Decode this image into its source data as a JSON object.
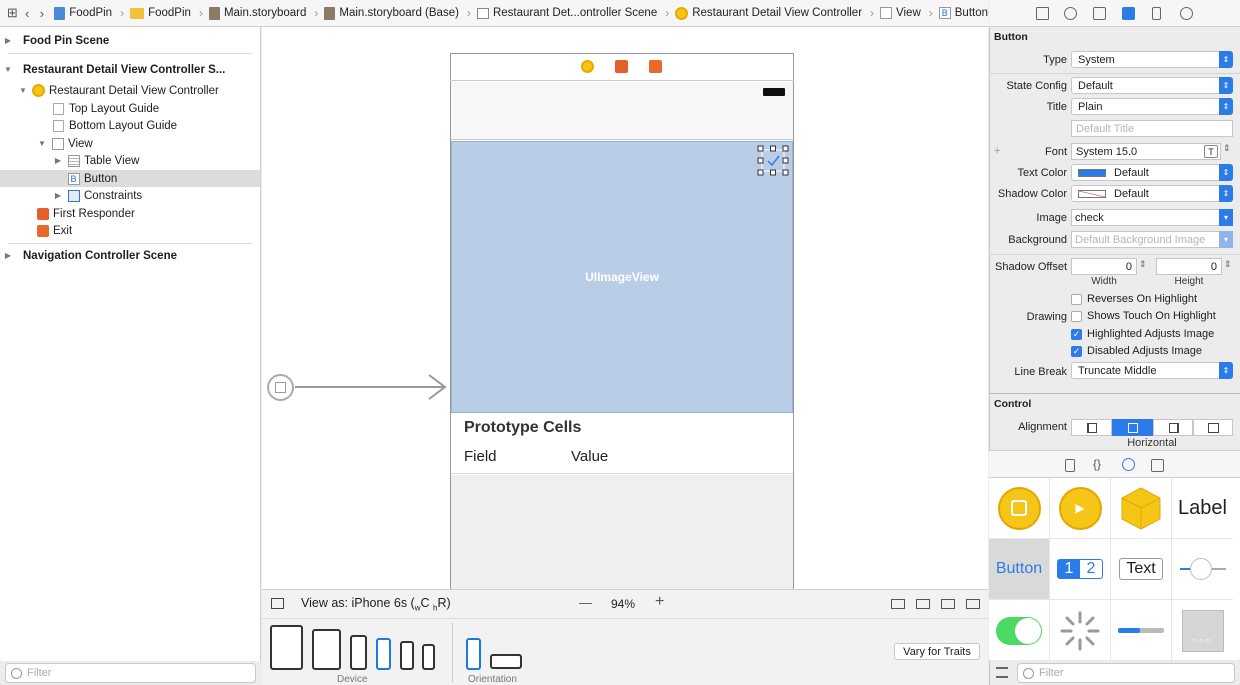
{
  "jumpbar": {
    "crumbs": [
      "FoodPin",
      "FoodPin",
      "Main.storyboard",
      "Main.storyboard (Base)",
      "Restaurant Det...ontroller Scene",
      "Restaurant Detail View Controller",
      "View",
      "Button"
    ]
  },
  "navigator": {
    "items": [
      {
        "label": "Food Pin Scene"
      },
      {
        "label": "Restaurant Detail View Controller S..."
      },
      {
        "label": "Restaurant Detail View Controller"
      },
      {
        "label": "Top Layout Guide"
      },
      {
        "label": "Bottom Layout Guide"
      },
      {
        "label": "View"
      },
      {
        "label": "Table View"
      },
      {
        "label": "Button"
      },
      {
        "label": "Constraints"
      },
      {
        "label": "First Responder"
      },
      {
        "label": "Exit"
      },
      {
        "label": "Navigation Controller Scene"
      }
    ],
    "filter_placeholder": "Filter"
  },
  "canvas": {
    "imageview_label": "UIImageView",
    "prototype_cells": "Prototype Cells",
    "cell_field": "Field",
    "cell_value": "Value",
    "view_as": "View as: iPhone 6s (",
    "traits_w": "w",
    "traits_C": "C",
    "traits_h": "h",
    "traits_R": "R)",
    "zoom": "94%",
    "minus": "—",
    "plus": "+",
    "device_label": "Device",
    "orientation_label": "Orientation",
    "vary_button": "Vary for Traits"
  },
  "inspector": {
    "button_section": "Button",
    "type_label": "Type",
    "type_value": "System",
    "state_label": "State Config",
    "state_value": "Default",
    "title_label": "Title",
    "title_value": "Plain",
    "default_title_ph": "Default Title",
    "font_label": "Font",
    "font_value": "System 15.0",
    "font_plus": "+",
    "textcolor_label": "Text Color",
    "textcolor_value": "Default",
    "shadowcolor_label": "Shadow Color",
    "shadowcolor_value": "Default",
    "image_label": "Image",
    "image_value": "check",
    "background_label": "Background",
    "background_ph": "Default Background Image",
    "shadowoffset_label": "Shadow Offset",
    "shadow_w": "0",
    "shadow_h": "0",
    "width_label": "Width",
    "height_label": "Height",
    "drawing_label": "Drawing",
    "reverses": "Reverses On Highlight",
    "shows_touch": "Shows Touch On Highlight",
    "highlighted_adj": "Highlighted Adjusts Image",
    "disabled_adj": "Disabled Adjusts Image",
    "linebreak_label": "Line Break",
    "linebreak_value": "Truncate Middle",
    "control_section": "Control",
    "alignment_label": "Alignment",
    "horizontal_label": "Horizontal",
    "checkmark": "✓",
    "colors": {
      "accent": "#2b7ce9",
      "text_color_swatch": "#2b7ce9",
      "shadow_color_swatch": "#ffffff"
    }
  },
  "library": {
    "label_item": "Label",
    "button_item": "Button",
    "seg_1": "1",
    "seg_2": "2",
    "text_item": "Text",
    "filter_placeholder": "Filter"
  }
}
